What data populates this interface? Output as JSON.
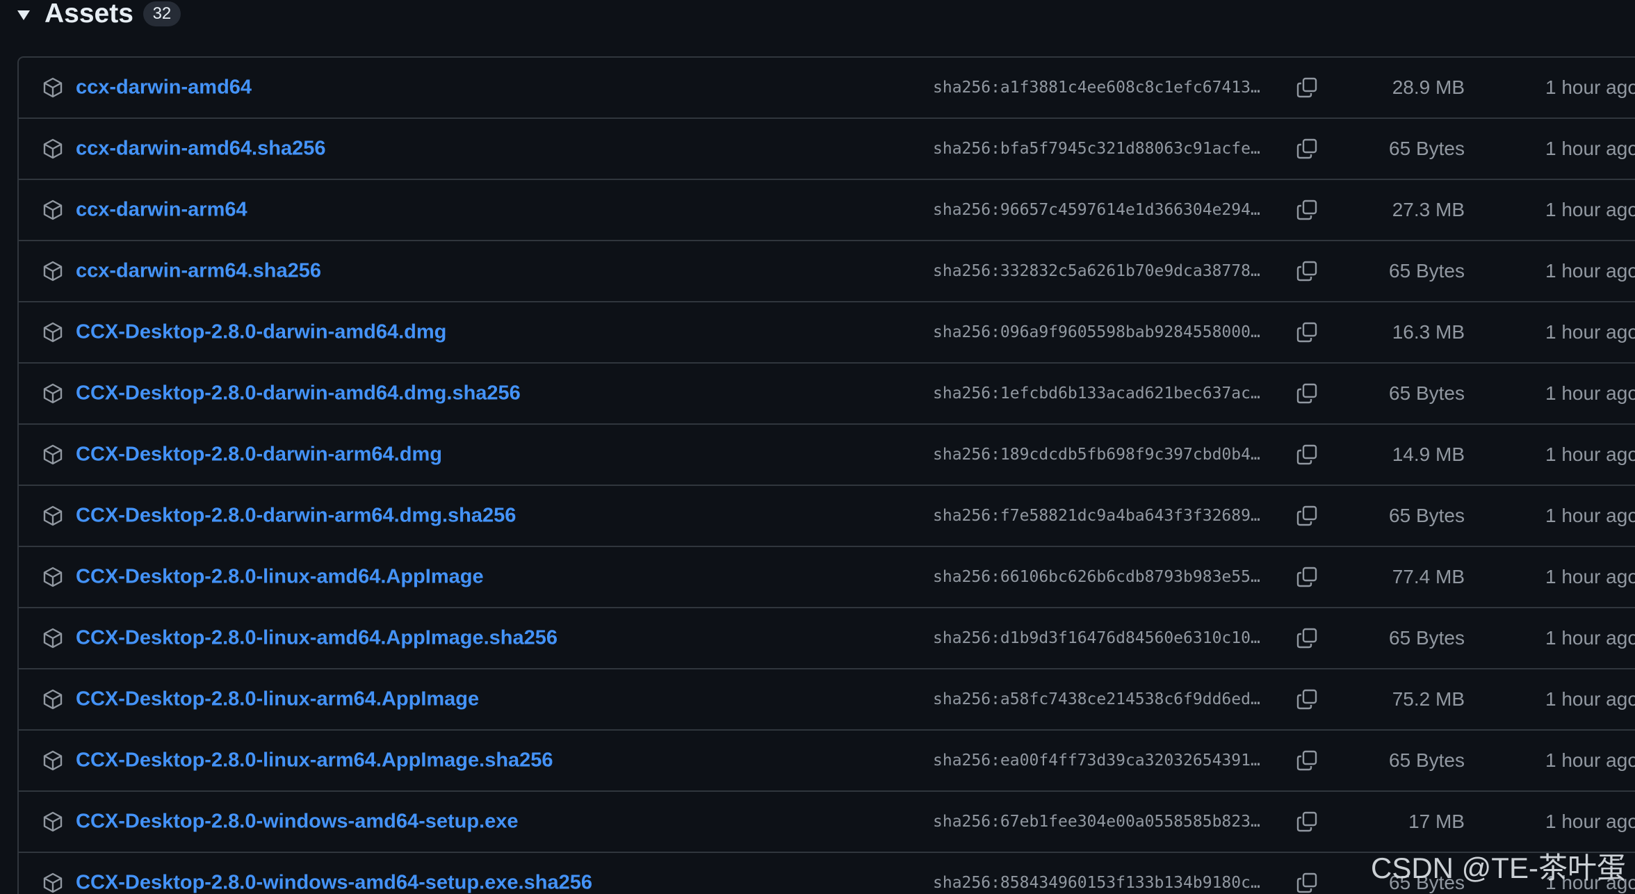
{
  "header": {
    "title": "Assets",
    "count": "32"
  },
  "assets": [
    {
      "name": "ccx-darwin-amd64",
      "sha": "sha256:a1f3881c4ee608c8c1efc67413…",
      "size": "28.9 MB",
      "time": "1 hour ago"
    },
    {
      "name": "ccx-darwin-amd64.sha256",
      "sha": "sha256:bfa5f7945c321d88063c91acfe…",
      "size": "65 Bytes",
      "time": "1 hour ago"
    },
    {
      "name": "ccx-darwin-arm64",
      "sha": "sha256:96657c4597614e1d366304e294…",
      "size": "27.3 MB",
      "time": "1 hour ago"
    },
    {
      "name": "ccx-darwin-arm64.sha256",
      "sha": "sha256:332832c5a6261b70e9dca38778…",
      "size": "65 Bytes",
      "time": "1 hour ago"
    },
    {
      "name": "CCX-Desktop-2.8.0-darwin-amd64.dmg",
      "sha": "sha256:096a9f9605598bab9284558000…",
      "size": "16.3 MB",
      "time": "1 hour ago"
    },
    {
      "name": "CCX-Desktop-2.8.0-darwin-amd64.dmg.sha256",
      "sha": "sha256:1efcbd6b133acad621bec637ac…",
      "size": "65 Bytes",
      "time": "1 hour ago"
    },
    {
      "name": "CCX-Desktop-2.8.0-darwin-arm64.dmg",
      "sha": "sha256:189cdcdb5fb698f9c397cbd0b4…",
      "size": "14.9 MB",
      "time": "1 hour ago"
    },
    {
      "name": "CCX-Desktop-2.8.0-darwin-arm64.dmg.sha256",
      "sha": "sha256:f7e58821dc9a4ba643f3f32689…",
      "size": "65 Bytes",
      "time": "1 hour ago"
    },
    {
      "name": "CCX-Desktop-2.8.0-linux-amd64.AppImage",
      "sha": "sha256:66106bc626b6cdb8793b983e55…",
      "size": "77.4 MB",
      "time": "1 hour ago"
    },
    {
      "name": "CCX-Desktop-2.8.0-linux-amd64.AppImage.sha256",
      "sha": "sha256:d1b9d3f16476d84560e6310c10…",
      "size": "65 Bytes",
      "time": "1 hour ago"
    },
    {
      "name": "CCX-Desktop-2.8.0-linux-arm64.AppImage",
      "sha": "sha256:a58fc7438ce214538c6f9dd6ed…",
      "size": "75.2 MB",
      "time": "1 hour ago"
    },
    {
      "name": "CCX-Desktop-2.8.0-linux-arm64.AppImage.sha256",
      "sha": "sha256:ea00f4ff73d39ca32032654391…",
      "size": "65 Bytes",
      "time": "1 hour ago"
    },
    {
      "name": "CCX-Desktop-2.8.0-windows-amd64-setup.exe",
      "sha": "sha256:67eb1fee304e00a0558585b823…",
      "size": "17 MB",
      "time": "1 hour ago"
    },
    {
      "name": "CCX-Desktop-2.8.0-windows-amd64-setup.exe.sha256",
      "sha": "sha256:858434960153f133b134b9180c…",
      "size": "65 Bytes",
      "time": "1 hour ago"
    }
  ],
  "icons": {
    "toggle": "triangle-down-icon",
    "asset": "package-icon",
    "copy": "copy-icon"
  },
  "colors": {
    "background": "#0d1117",
    "link": "#4493f8",
    "muted": "#9198a1",
    "border": "#30363d"
  },
  "watermark": "CSDN @TE-茶叶蛋"
}
